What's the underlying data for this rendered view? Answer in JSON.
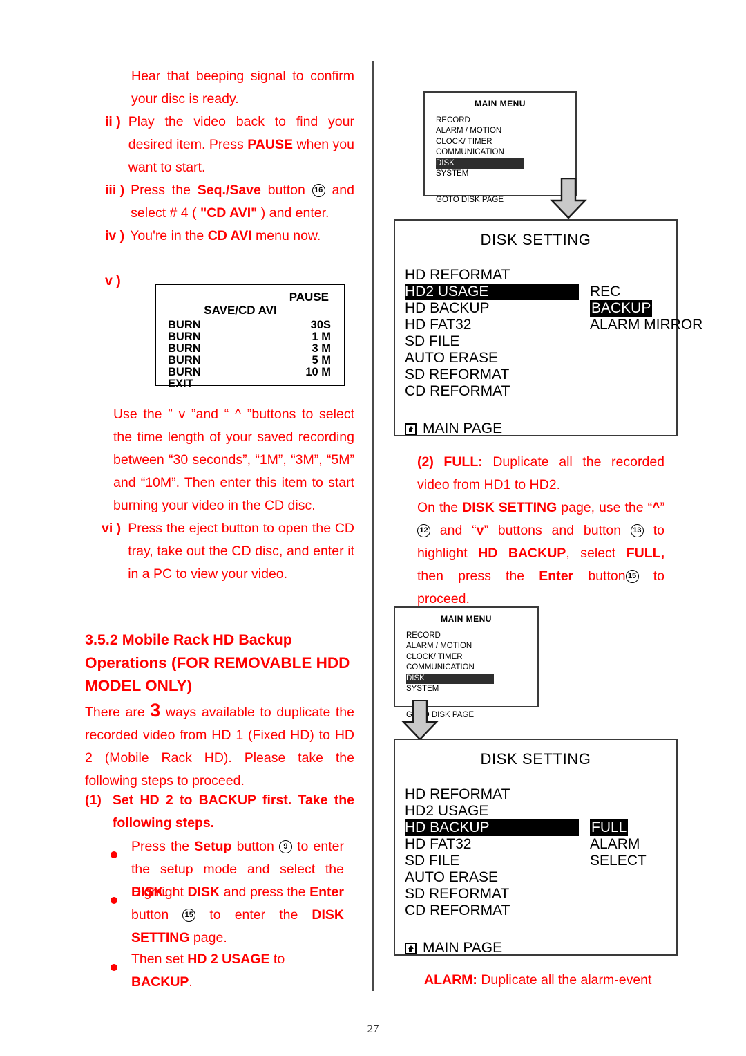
{
  "page": {
    "number": "27",
    "accent_color": "#ff0000"
  },
  "left_column": {
    "item_i_cont": {
      "text": "Hear that beeping signal to confirm your disc is ready."
    },
    "item_ii": {
      "marker": "ii )",
      "text_a": "Play the video back to find your desired item. Press ",
      "bold_a": "PAUSE",
      "text_b": " when you want to start."
    },
    "item_iii": {
      "marker": "iii )",
      "text_a": "Press the ",
      "bold_a": "Seq./Save",
      "text_b": " button ",
      "button_num": "16",
      "text_c": " and select # 4 ( ",
      "bold_b": "\"CD AVI\"",
      "text_d": " ) and enter."
    },
    "item_iv": {
      "marker": "iv )",
      "text_a": "You're in the ",
      "bold_a": "CD AVI",
      "text_b": " menu now."
    },
    "item_v": {
      "marker": "v )"
    },
    "burn_screen": {
      "pause_label": "PAUSE",
      "subtitle": "SAVE/CD AVI",
      "rows": [
        {
          "label": "BURN",
          "value": "30S"
        },
        {
          "label": "BURN",
          "value": "1 M"
        },
        {
          "label": "BURN",
          "value": "3 M"
        },
        {
          "label": "BURN",
          "value": "5 M"
        },
        {
          "label": "BURN",
          "value": "10 M"
        },
        {
          "label": "EXIT",
          "value": ""
        }
      ]
    },
    "para_use": {
      "text": "Use the ” v ”and “ ^ ”buttons to select the time length of your saved recording between “30 seconds”, “1M”, “3M”, “5M” and “10M”. Then enter this item to start burning your video in the CD disc."
    },
    "item_vi": {
      "marker": "vi )",
      "text": "Press the eject button to open the CD tray, take out the CD disc, and enter it in a PC to view your video."
    },
    "section_heading": {
      "line1": "3.5.2 Mobile Rack HD Backup",
      "line2": "Operations (FOR REMOVABLE HDD",
      "line3": "MODEL ONLY)"
    },
    "para_there_are": {
      "text_a": "There are ",
      "big_number": "3",
      "text_b": " ways available to duplicate the recorded video from HD 1 (Fixed HD) to HD 2 (Mobile Rack HD). Please take the following steps to proceed."
    },
    "step1": {
      "marker": "(1)",
      "text": "Set HD 2 to BACKUP first. Take the following steps."
    },
    "bullets": [
      {
        "text_a": "Press the ",
        "bold_a": "Setup",
        "text_b": " button ",
        "button_num": "9",
        "text_c": " to enter the setup mode and select the ",
        "bold_b": "DISK",
        "text_d": "."
      },
      {
        "text_a": "Highlight ",
        "bold_a": "DISK",
        "text_b": " and press the ",
        "bold_b": "Enter",
        "text_c": " button ",
        "button_num": "15",
        "text_d": " to enter the ",
        "bold_c": "DISK SETTING",
        "text_e": " page."
      },
      {
        "text_a": "Then set ",
        "bold_a": "HD 2 USAGE",
        "text_b": " to ",
        "bold_b": "BACKUP",
        "text_c": "."
      }
    ]
  },
  "right_column": {
    "main_menu_top": {
      "title": "MAIN MENU",
      "items": [
        "RECORD",
        "ALARM / MOTION",
        "CLOCK/ TIMER",
        "COMMUNICATION",
        "DISK",
        "SYSTEM"
      ],
      "selected": "DISK",
      "footer": "GOTO DISK PAGE"
    },
    "disk_setting_top": {
      "title": "DISK SETTING",
      "rows": [
        {
          "label": "HD REFORMAT",
          "value": "",
          "label_highlight": false,
          "value_highlight": false
        },
        {
          "label": "HD2 USAGE",
          "value": "REC",
          "label_highlight": true,
          "value_highlight": false
        },
        {
          "label": "HD BACKUP",
          "value": "BACKUP",
          "label_highlight": false,
          "value_highlight": true
        },
        {
          "label": "HD FAT32",
          "value": "ALARM MIRROR",
          "label_highlight": false,
          "value_highlight": false
        },
        {
          "label": "SD FILE",
          "value": "",
          "label_highlight": false,
          "value_highlight": false
        },
        {
          "label": "AUTO ERASE",
          "value": "",
          "label_highlight": false,
          "value_highlight": false
        },
        {
          "label": "SD REFORMAT",
          "value": "",
          "label_highlight": false,
          "value_highlight": false
        },
        {
          "label": "CD REFORMAT",
          "value": "",
          "label_highlight": false,
          "value_highlight": false
        }
      ],
      "main_page_label": "MAIN PAGE"
    },
    "para_full": {
      "marker": "(2) FULL:",
      "text_a": " Duplicate all the recorded video from HD1 to HD2."
    },
    "para_on_disk": {
      "text_a": "On the ",
      "bold_a": "DISK SETTING",
      "text_b": " page, use the “",
      "bold_up": "^",
      "text_c": "” ",
      "button_num_1": "12",
      "text_d": " and “",
      "bold_down": "v",
      "text_e": "” buttons and button ",
      "button_num_2": "13",
      "text_f": " to highlight ",
      "bold_b": "HD BACKUP",
      "text_g": ", select ",
      "bold_c": "FULL,",
      "text_h": " then press the ",
      "bold_d": "Enter",
      "text_i": " button",
      "button_num_3": "15",
      "text_j": " to proceed."
    },
    "main_menu_bottom": {
      "title": "MAIN MENU",
      "items": [
        "RECORD",
        "ALARM / MOTION",
        "CLOCK/ TIMER",
        "COMMUNICATION",
        "DISK",
        "SYSTEM"
      ],
      "selected": "DISK",
      "footer": "GOTO DISK PAGE"
    },
    "disk_setting_bottom": {
      "title": "DISK SETTING",
      "rows": [
        {
          "label": "HD REFORMAT",
          "value": "",
          "label_highlight": false,
          "value_highlight": false
        },
        {
          "label": "HD2 USAGE",
          "value": "",
          "label_highlight": false,
          "value_highlight": false
        },
        {
          "label": "HD BACKUP",
          "value": "FULL",
          "label_highlight": true,
          "value_highlight": true
        },
        {
          "label": "HD FAT32",
          "value": "ALARM",
          "label_highlight": false,
          "value_highlight": false
        },
        {
          "label": "SD FILE",
          "value": "SELECT",
          "label_highlight": false,
          "value_highlight": false
        },
        {
          "label": "AUTO ERASE",
          "value": "",
          "label_highlight": false,
          "value_highlight": false
        },
        {
          "label": "SD REFORMAT",
          "value": "",
          "label_highlight": false,
          "value_highlight": false
        },
        {
          "label": "CD REFORMAT",
          "value": "",
          "label_highlight": false,
          "value_highlight": false
        }
      ],
      "main_page_label": "MAIN PAGE"
    },
    "para_alarm": {
      "marker": "ALARM:",
      "text": " Duplicate all the alarm-event"
    }
  }
}
